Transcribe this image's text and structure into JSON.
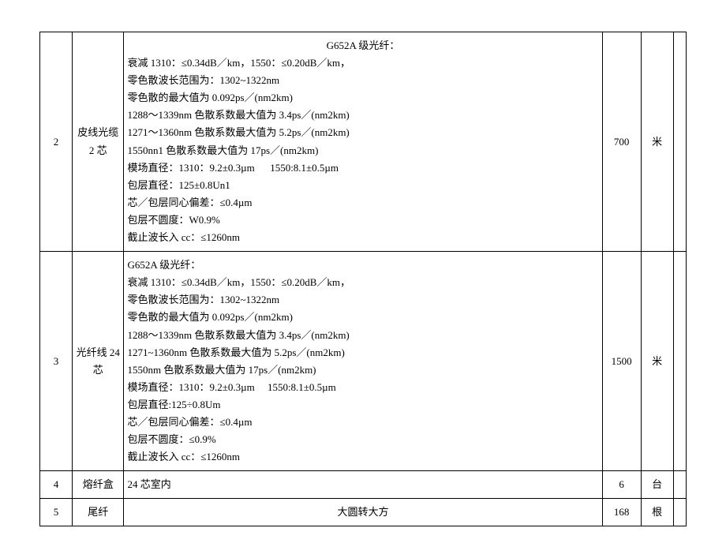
{
  "rows": [
    {
      "num": "2",
      "name": "皮线光缆 2 芯",
      "spec_header": "G652A 级光纤：",
      "spec_lines": [
        "衰减 1310：≤0.34dB／km，1550：≤0.20dB／km，",
        "零色散波长范围为：1302~1322nm",
        "零色散的最大值为 0.092ps／(nm2km)",
        "1288～1339nm 色散系数最大值为 3.4ps／(nm2km)",
        "1271～1360nm 色散系数最大值为 5.2ps／(nm2km)",
        "1550nn1 色散系数最大值为 17ps／(nm2km)",
        "模场直径：1310：9.2±0.3µm      1550:8.1±0.5µm",
        "包层直径：125±0.8Un1",
        "芯／包层同心偏差：≤0.4µm",
        "包层不圆度：W0.9%",
        "截止波长入 cc：≤1260nm"
      ],
      "qty": "700",
      "unit": "米"
    },
    {
      "num": "3",
      "name": "光纤线 24 芯",
      "spec_header": "",
      "spec_lines": [
        "G652A 级光纤：",
        "衰减 1310：≤0.34dB／km，1550：≤0.20dB／km，",
        "零色散波长范围为：1302~1322nm",
        "零色散的最大值为 0.092ps／(nm2km)",
        "1288～1339nm 色散系数最大值为 3.4ps／(nm2km)",
        "1271~1360nm 色散系数最大值为 5.2ps／(nm2km)",
        "1550nm 色散系数最大值为 17ps／(nm2km)",
        "模场直径：1310：9.2±0.3µm     1550:8.1±0.5µm",
        "包层直径:125÷0.8Um",
        "芯／包层同心偏差：≤0.4µm",
        "包层不圆度：≤0.9%",
        "截止波长入 cc：≤1260nm"
      ],
      "qty": "1500",
      "unit": "米"
    },
    {
      "num": "4",
      "name": "熔纤盒",
      "spec_header": "",
      "spec_lines": [
        "24 芯室内"
      ],
      "qty": "6",
      "unit": "台"
    },
    {
      "num": "5",
      "name": "尾纤",
      "spec_header": "",
      "spec_center": "大圆转大方",
      "qty": "168",
      "unit": "根"
    }
  ]
}
